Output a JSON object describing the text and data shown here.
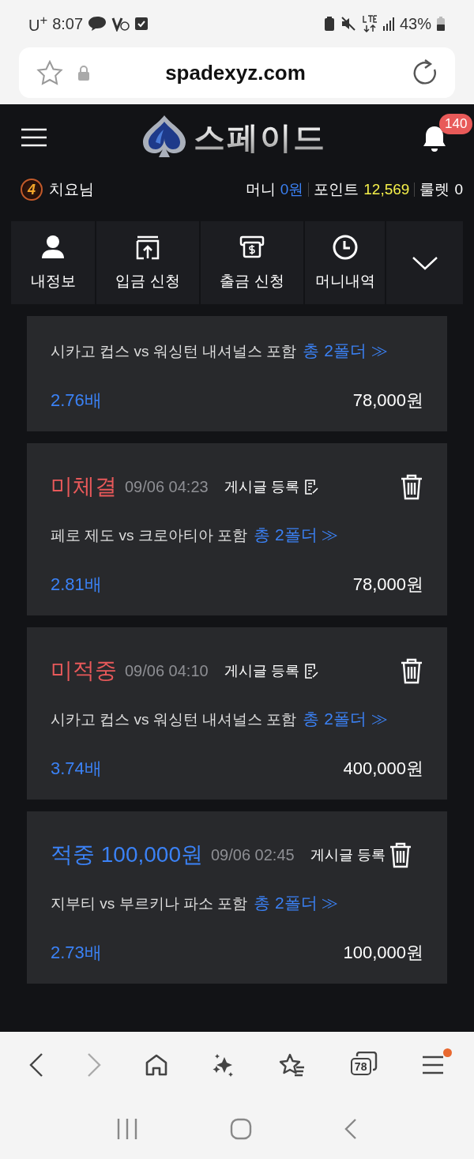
{
  "status_bar": {
    "carrier": "U$^{+}$",
    "time": "8:07",
    "battery": "43%"
  },
  "url_bar": {
    "url": "spadexyz.com"
  },
  "header": {
    "logo_text": "스페이드",
    "notification_count": "140"
  },
  "user": {
    "level": "4",
    "name": "치요님",
    "money_label": "머니",
    "money": "0원",
    "points_label": "포인트",
    "points": "12,569",
    "roulette_label": "룰렛",
    "roulette": "0"
  },
  "quick_menu": [
    {
      "kind": "person",
      "label": "내정보"
    },
    {
      "kind": "deposit",
      "label": "입금 신청"
    },
    {
      "kind": "withdraw",
      "label": "출금 신청"
    },
    {
      "kind": "history",
      "label": "머니내역"
    },
    {
      "kind": "expand"
    }
  ],
  "bets": [
    {
      "match": "시카고 컵스 vs 워싱턴 내셔널스 포함",
      "folder": "총 2폴더 ≫",
      "odds": "2.76배",
      "amount": "78,000원"
    },
    {
      "kind": "pending",
      "status": "미체결",
      "date": "09/06 04:23",
      "register": "게시글 등록",
      "match": "페로 제도 vs 크로아티아 포함",
      "folder": "총 2폴더 ≫",
      "odds": "2.81배",
      "amount": "78,000원"
    },
    {
      "kind": "miss",
      "status": "미적중",
      "date": "09/06 04:10",
      "register": "게시글 등록",
      "match": "시카고 컵스 vs 워싱턴 내셔널스 포함",
      "folder": "총 2폴더 ≫",
      "odds": "3.74배",
      "amount": "400,000원"
    },
    {
      "kind": "win",
      "status": "적중 100,000원",
      "date": "09/06 02:45",
      "register": "게시글 등록",
      "match": "지부티 vs 부르키나 파소 포함",
      "folder": "총 2폴더 ≫",
      "odds": "2.73배",
      "amount": "100,000원"
    }
  ],
  "browser_toolbar": {
    "forward_disabled": true,
    "tab_count": "78",
    "menu_notification": true
  }
}
